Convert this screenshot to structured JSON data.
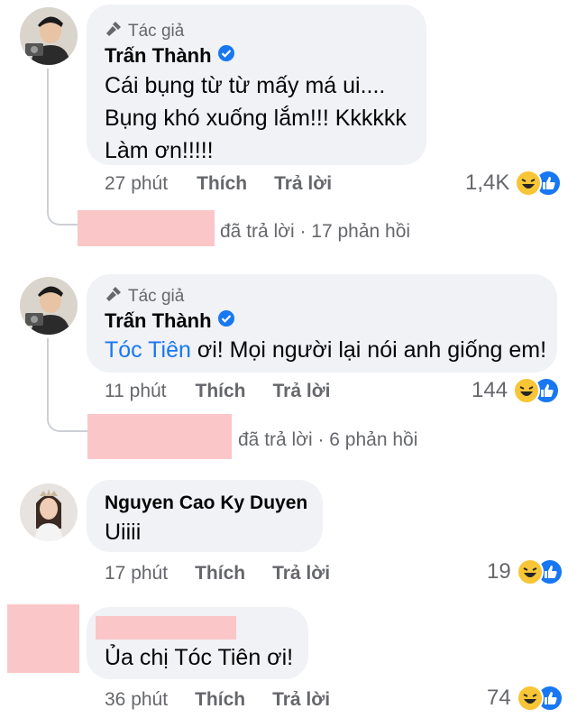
{
  "comments": [
    {
      "author_badge": "Tác giả",
      "name": "Trấn Thành",
      "text": "Cái bụng từ từ mấy má ui....\nBụng khó xuống lắm!!! Kkkkkk\nLàm ơn!!!!!",
      "time": "27 phút",
      "like": "Thích",
      "reply": "Trả lời",
      "reaction_count": "1,4K",
      "replies_summary": "đã trả lời · 17 phản hồi"
    },
    {
      "author_badge": "Tác giả",
      "name": "Trấn Thành",
      "mention": "Tóc Tiên",
      "text": " ơi! Mọi người lại nói anh giống em!",
      "time": "11 phút",
      "like": "Thích",
      "reply": "Trả lời",
      "reaction_count": "144",
      "replies_summary": "đã trả lời · 6 phản hồi"
    },
    {
      "name": "Nguyen Cao Ky Duyen",
      "text": "Uiiii",
      "time": "17 phút",
      "like": "Thích",
      "reply": "Trả lời",
      "reaction_count": "19"
    },
    {
      "text": "Ủa chị Tóc Tiên ơi!",
      "time": "36 phút",
      "like": "Thích",
      "reply": "Trả lời",
      "reaction_count": "74"
    }
  ],
  "colors": {
    "bubble": "#f0f2f5",
    "mention": "#1877f2",
    "verified": "#1877f2",
    "redaction": "#fbc6c8"
  }
}
